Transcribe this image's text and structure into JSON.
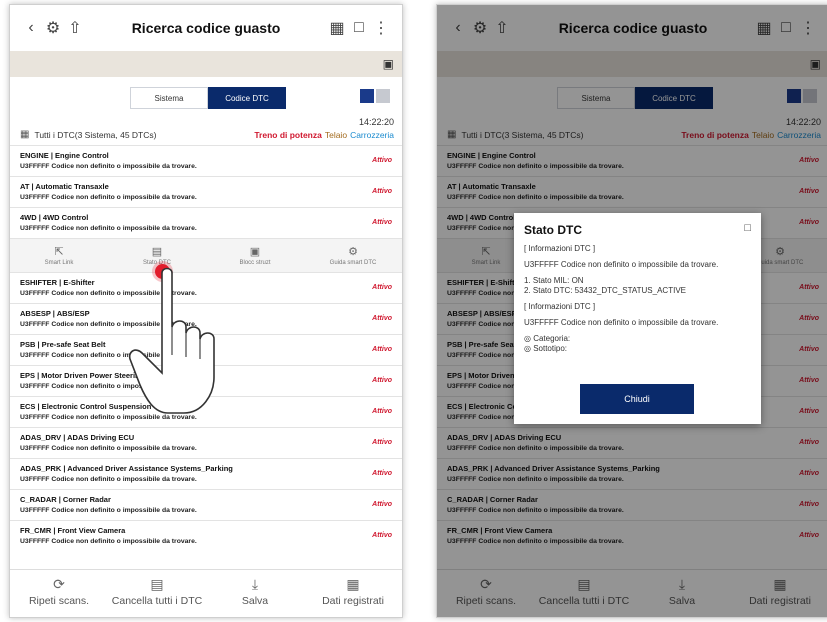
{
  "screen_main": {
    "title": "Ricerca codice guasto",
    "tabs": [
      "Sistema",
      "Codice DTC"
    ],
    "time": "14:22:20",
    "filter_text": "Tutti i DTC(3 Sistema, 45 DTCs)",
    "filters": [
      "Treno di potenza",
      "Telaio",
      "Carrozzeria"
    ],
    "rows": [
      {
        "title": "ENGINE | Engine Control",
        "desc": "U3FFFFF Codice non definito o impossibile da trovare.",
        "status": "Attivo"
      },
      {
        "title": "AT | Automatic Transaxle",
        "desc": "U3FFFFF Codice non definito o impossibile da trovare.",
        "status": "Attivo"
      },
      {
        "title": "4WD | 4WD Control",
        "desc": "U3FFFFF Codice non definito o impossibile da trovare.",
        "status": "Attivo"
      },
      {
        "title": "ESHIFTER | E-Shifter",
        "desc": "U3FFFFF Codice non definito o impossibile da trovare.",
        "status": "Attivo"
      },
      {
        "title": "ABSESP | ABS/ESP",
        "desc": "U3FFFFF Codice non definito o impossibile da trovare.",
        "status": "Attivo"
      },
      {
        "title": "PSB | Pre-safe Seat Belt",
        "desc": "U3FFFFF Codice non definito o impossibile da trovare.",
        "status": "Attivo"
      },
      {
        "title": "EPS | Motor Driven Power Steering",
        "desc": "U3FFFFF Codice non definito o impossibile da trovare.",
        "status": "Attivo"
      },
      {
        "title": "ECS | Electronic Control Suspension",
        "desc": "U3FFFFF Codice non definito o impossibile da trovare.",
        "status": "Attivo"
      },
      {
        "title": "ADAS_DRV | ADAS Driving ECU",
        "desc": "U3FFFFF Codice non definito o impossibile da trovare.",
        "status": "Attivo"
      },
      {
        "title": "ADAS_PRK | Advanced Driver Assistance Systems_Parking",
        "desc": "U3FFFFF Codice non definito o impossibile da trovare.",
        "status": "Attivo"
      },
      {
        "title": "C_RADAR | Corner Radar",
        "desc": "U3FFFFF Codice non definito o impossibile da trovare.",
        "status": "Attivo"
      },
      {
        "title": "FR_CMR | Front View Camera",
        "desc": "U3FFFFF Codice non definito o impossibile da trovare.",
        "status": "Attivo"
      }
    ],
    "actions": [
      "Smart Link",
      "Stato DTC",
      "Blocc struzt",
      "Guida smart DTC"
    ],
    "bottom": [
      "Ripeti scans.",
      "Cancella tutti i DTC",
      "Salva",
      "Dati registrati"
    ]
  },
  "dialog": {
    "title": "Stato DTC",
    "section1": "[ Informazioni DTC ]",
    "code_line": "U3FFFFF  Codice non definito o impossibile da trovare.",
    "mil": "1. Stato MIL: ON",
    "dtc_status": "2. Stato DTC: 53432_DTC_STATUS_ACTIVE",
    "section2": "[ Informazioni DTC ]",
    "code_line2": "U3FFFFF  Codice non definito o impossibile da trovare.",
    "categoria": "◎ Categoria:",
    "sottotipo": "◎ Sottotipo:",
    "close": "Chiudi"
  },
  "colors": {
    "accent": "#0a2a6b",
    "active": "#d0182f",
    "band": "#e9e4dc"
  }
}
